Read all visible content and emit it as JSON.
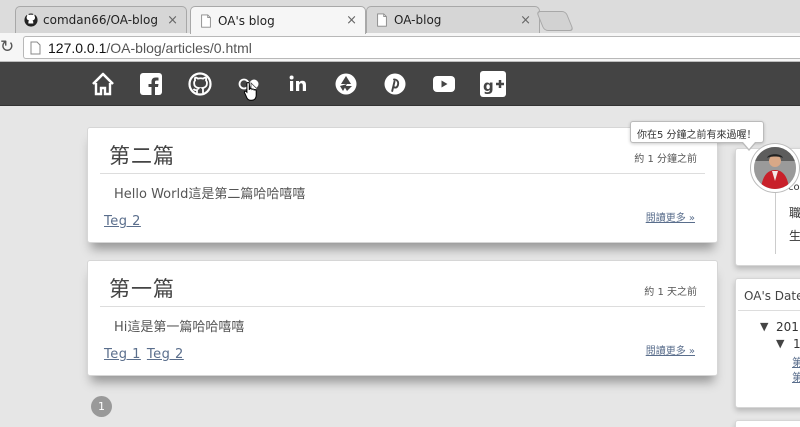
{
  "tabs": [
    {
      "title": "comdan66/OA-blog",
      "icon": "github-icon"
    },
    {
      "title": "OA's blog",
      "icon": "page-icon",
      "active": true
    },
    {
      "title": "OA-blog",
      "icon": "page-icon"
    }
  ],
  "tab_close": "×",
  "address": {
    "host": "127.0.0.1",
    "path": "/OA-blog/articles/0.html"
  },
  "nav_icons": [
    "home-icon",
    "facebook-icon",
    "github-icon",
    "flickr-icon",
    "linkedin-icon",
    "picasa-icon",
    "pinterest-icon",
    "youtube-icon",
    "google-plus-icon"
  ],
  "posts": [
    {
      "title": "第二篇",
      "time": "約 1 分鐘之前",
      "body": "Hello World這是第二篇哈哈嘻嘻",
      "tags": [
        "Teg 2"
      ],
      "read_more": "閱讀更多 »"
    },
    {
      "title": "第一篇",
      "time": "約 1 天之前",
      "body": "Hi這是第一篇哈哈嘻嘻",
      "tags": [
        "Teg 1",
        "Teg 2"
      ],
      "read_more": "閱讀更多 »"
    }
  ],
  "pagination": {
    "current": "1"
  },
  "sidebar": {
    "tooltip": "你在5 分鐘之前有來過喔！",
    "profile_lines": [
      "co",
      "職",
      "生"
    ],
    "archive_title": "OA's Date",
    "archive_year": "201",
    "archive_sub": "1",
    "archive_links": [
      "第",
      "第"
    ]
  },
  "colors": {
    "navbar": "#444444",
    "link": "#5a6e8c",
    "background": "#e6e6e6"
  }
}
